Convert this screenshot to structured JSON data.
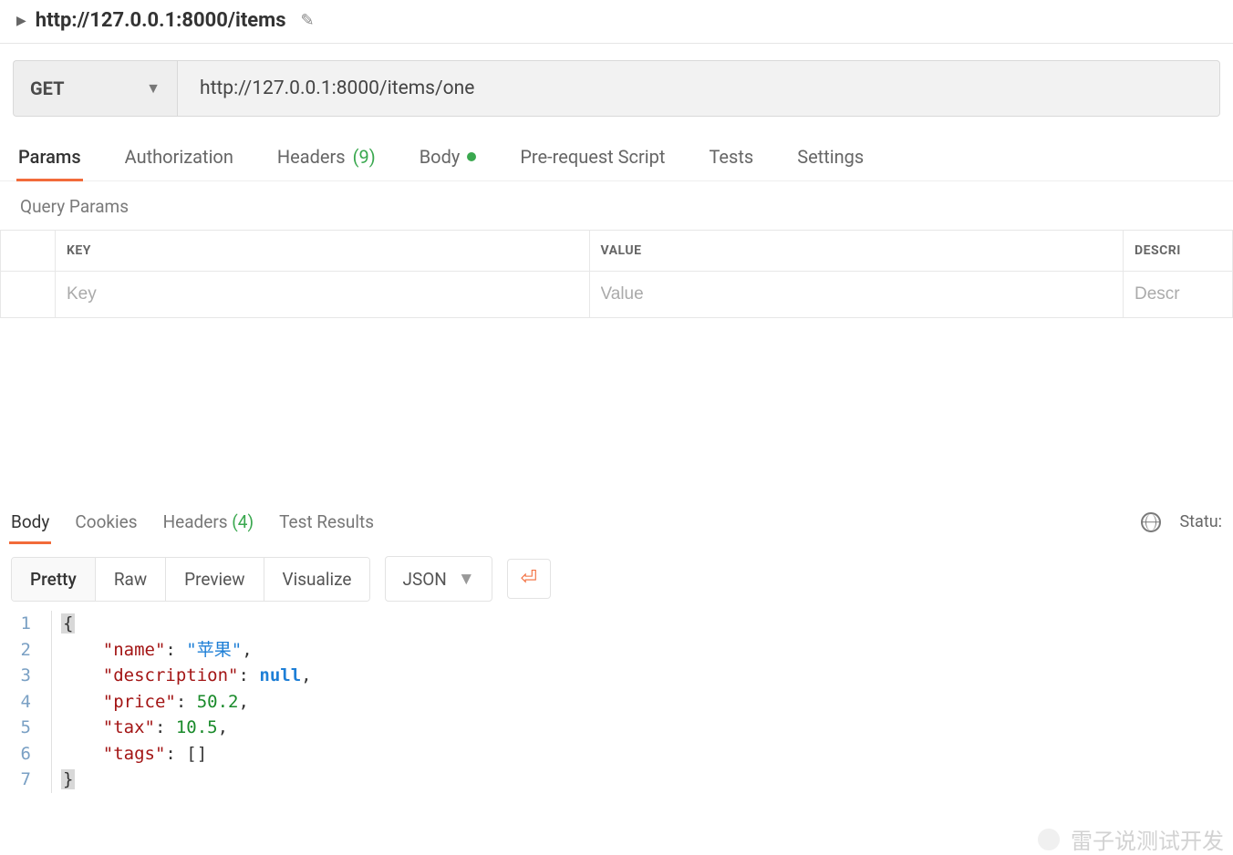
{
  "title": "http://127.0.0.1:8000/items",
  "request": {
    "method": "GET",
    "url": "http://127.0.0.1:8000/items/one"
  },
  "tabs": {
    "params": "Params",
    "authorization": "Authorization",
    "headers_label": "Headers",
    "headers_count": "(9)",
    "body": "Body",
    "pre_request": "Pre-request Script",
    "tests": "Tests",
    "settings": "Settings",
    "active": "params"
  },
  "query_params": {
    "section_label": "Query Params",
    "columns": {
      "key": "KEY",
      "value": "VALUE",
      "description": "DESCRI"
    },
    "placeholders": {
      "key": "Key",
      "value": "Value",
      "description": "Descr"
    }
  },
  "response": {
    "tabs": {
      "body": "Body",
      "cookies": "Cookies",
      "headers_label": "Headers",
      "headers_count": "(4)",
      "test_results": "Test Results",
      "active": "body"
    },
    "status_label": "Statu:",
    "view_modes": {
      "pretty": "Pretty",
      "raw": "Raw",
      "preview": "Preview",
      "visualize": "Visualize",
      "active": "pretty"
    },
    "format_select": "JSON",
    "code": [
      {
        "n": "1",
        "indent": 0,
        "tokens": [
          {
            "t": "brace_hl",
            "v": "{"
          }
        ]
      },
      {
        "n": "2",
        "indent": 1,
        "tokens": [
          {
            "t": "key",
            "v": "\"name\""
          },
          {
            "t": "p",
            "v": ": "
          },
          {
            "t": "str",
            "v": "\"苹果\""
          },
          {
            "t": "p",
            "v": ","
          }
        ]
      },
      {
        "n": "3",
        "indent": 1,
        "tokens": [
          {
            "t": "key",
            "v": "\"description\""
          },
          {
            "t": "p",
            "v": ": "
          },
          {
            "t": "null",
            "v": "null"
          },
          {
            "t": "p",
            "v": ","
          }
        ]
      },
      {
        "n": "4",
        "indent": 1,
        "tokens": [
          {
            "t": "key",
            "v": "\"price\""
          },
          {
            "t": "p",
            "v": ": "
          },
          {
            "t": "num",
            "v": "50.2"
          },
          {
            "t": "p",
            "v": ","
          }
        ]
      },
      {
        "n": "5",
        "indent": 1,
        "tokens": [
          {
            "t": "key",
            "v": "\"tax\""
          },
          {
            "t": "p",
            "v": ": "
          },
          {
            "t": "num",
            "v": "10.5"
          },
          {
            "t": "p",
            "v": ","
          }
        ]
      },
      {
        "n": "6",
        "indent": 1,
        "tokens": [
          {
            "t": "key",
            "v": "\"tags\""
          },
          {
            "t": "p",
            "v": ": []"
          }
        ]
      },
      {
        "n": "7",
        "indent": 0,
        "tokens": [
          {
            "t": "brace_hl",
            "v": "}"
          }
        ]
      }
    ]
  },
  "watermark": "雷子说测试开发"
}
